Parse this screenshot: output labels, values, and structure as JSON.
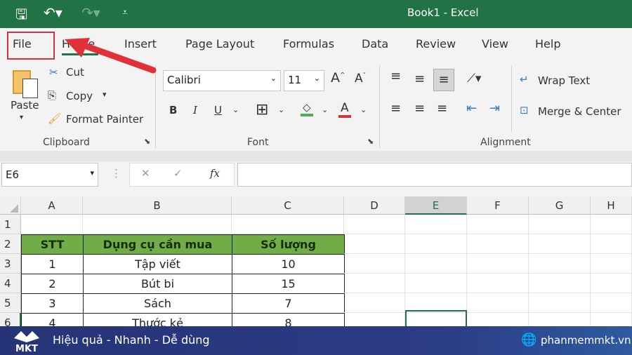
{
  "titlebar": {
    "title": "Book1  -  Excel",
    "icons": [
      "save-icon",
      "undo-icon",
      "redo-icon",
      "customize-qat-icon"
    ]
  },
  "tabs": [
    "File",
    "Home",
    "Insert",
    "Page Layout",
    "Formulas",
    "Data",
    "Review",
    "View",
    "Help"
  ],
  "ribbon": {
    "clipboard": {
      "paste": "Paste",
      "cut": "Cut",
      "copy": "Copy",
      "format_painter": "Format Painter",
      "label": "Clipboard"
    },
    "font": {
      "name": "Calibri",
      "size": "11",
      "bold": "B",
      "italic": "I",
      "underline": "U",
      "label": "Font"
    },
    "alignment": {
      "wrap": "Wrap Text",
      "merge": "Merge & Center",
      "label": "Alignment"
    }
  },
  "formula_bar": {
    "name_box": "E6",
    "fx": "fx",
    "value": ""
  },
  "columns": [
    "A",
    "B",
    "C",
    "D",
    "E",
    "F",
    "G",
    "H"
  ],
  "rows": [
    "1",
    "2",
    "3",
    "4",
    "5",
    "6"
  ],
  "table": {
    "headers": [
      "STT",
      "Dụng cụ cần mua",
      "Số lượng"
    ],
    "rows": [
      [
        "1",
        "Tập viết",
        "10"
      ],
      [
        "2",
        "Bút bi",
        "15"
      ],
      [
        "3",
        "Sách",
        "7"
      ],
      [
        "4",
        "Thước kẻ",
        "8"
      ]
    ]
  },
  "footer": {
    "logo": "MKT",
    "slogan": "Hiệu quả - Nhanh - Dễ dùng",
    "site": "phanmemmkt.vn"
  },
  "colors": {
    "excel_green": "#217346",
    "header_fill": "#70ad47",
    "highlight": "#d0343c",
    "footer": "#263477"
  }
}
